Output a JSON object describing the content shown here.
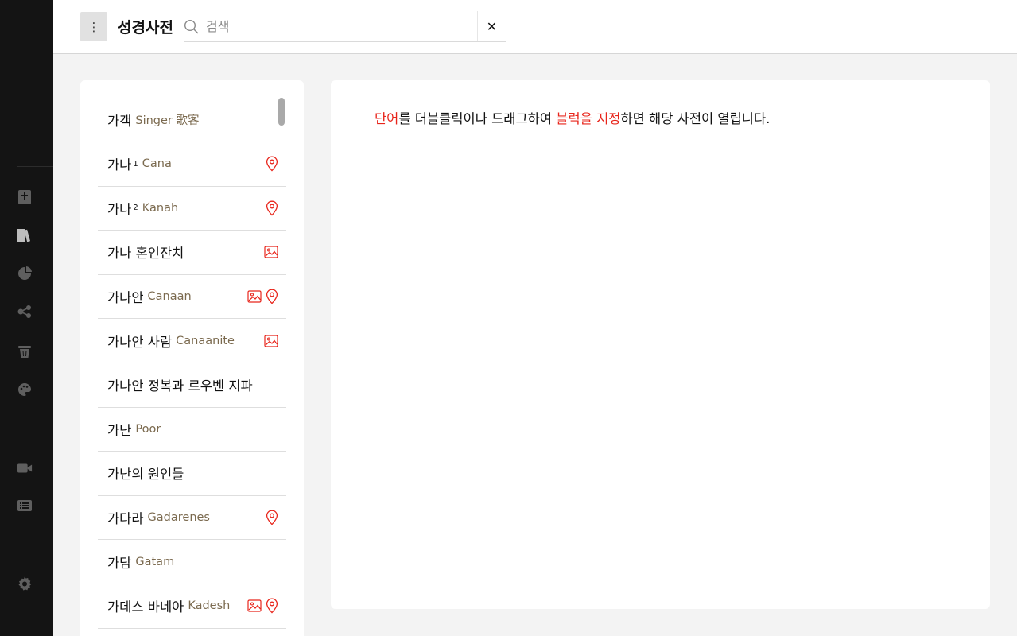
{
  "header": {
    "menu_glyph": "⋮",
    "title": "성경사전",
    "search": {
      "value": "",
      "placeholder": "검색"
    },
    "clear_glyph": "✕"
  },
  "rail": {
    "icons": [
      "bible-icon",
      "library-icon",
      "pie-chart-icon",
      "share-nodes-icon",
      "basket-icon",
      "palette-icon",
      "video-camera-icon",
      "list-icon",
      "gear-icon"
    ]
  },
  "list": {
    "items": [
      {
        "ko": "가객",
        "sup": "",
        "en": "Singer 歌客",
        "icons": []
      },
      {
        "ko": "가나",
        "sup": "1",
        "en": "Cana",
        "icons": [
          "map-pin-icon"
        ]
      },
      {
        "ko": "가나",
        "sup": "2",
        "en": "Kanah",
        "icons": [
          "map-pin-icon"
        ]
      },
      {
        "ko": "가나 혼인잔치",
        "sup": "",
        "en": "",
        "icons": [
          "image-icon"
        ]
      },
      {
        "ko": "가나안",
        "sup": "",
        "en": "Canaan",
        "icons": [
          "image-icon",
          "map-pin-icon"
        ]
      },
      {
        "ko": "가나안 사람",
        "sup": "",
        "en": "Canaanite",
        "icons": [
          "image-icon"
        ]
      },
      {
        "ko": "가나안 정복과 르우벤 지파",
        "sup": "",
        "en": "",
        "icons": []
      },
      {
        "ko": "가난",
        "sup": "",
        "en": "Poor",
        "icons": []
      },
      {
        "ko": "가난의 원인들",
        "sup": "",
        "en": "",
        "icons": []
      },
      {
        "ko": "가다라",
        "sup": "",
        "en": "Gadarenes",
        "icons": [
          "map-pin-icon"
        ]
      },
      {
        "ko": "가담",
        "sup": "",
        "en": "Gatam",
        "icons": []
      },
      {
        "ko": "가데스 바네아",
        "sup": "",
        "en": "Kadesh",
        "icons": [
          "image-icon",
          "map-pin-icon"
        ]
      }
    ]
  },
  "content": {
    "hint": {
      "part1": "단어",
      "part2": "를 더블클릭이나 드래그하여 ",
      "part3": "블럭을 지정",
      "part4": "하면 해당 사전이 열립니다."
    }
  },
  "colors": {
    "accent": "#e8251b",
    "english_term": "#7b6a4f",
    "rail_bg": "#141414",
    "rail_icon": "#5f5f5f",
    "rail_icon_active": "#bdbdbd"
  }
}
